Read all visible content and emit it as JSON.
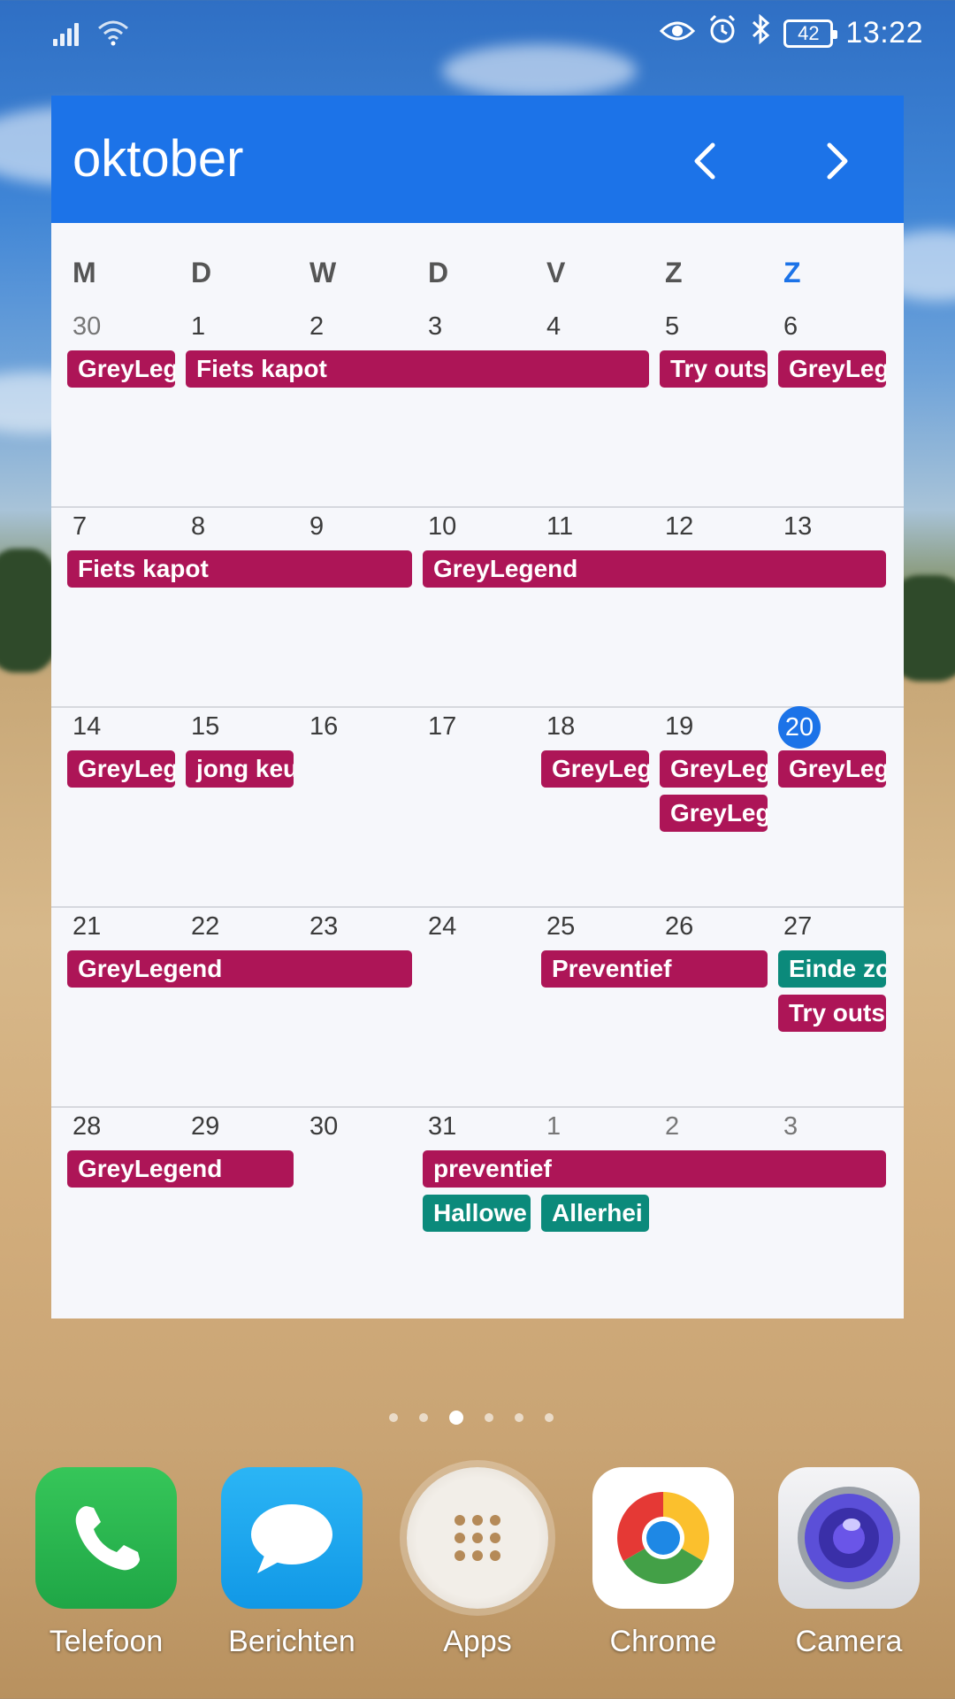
{
  "status_bar": {
    "battery": "42",
    "time": "13:22"
  },
  "widget": {
    "month": "oktober",
    "weekdays": [
      "M",
      "D",
      "W",
      "D",
      "V",
      "Z",
      "Z"
    ],
    "weeks": [
      {
        "days": [
          "30",
          "1",
          "2",
          "3",
          "4",
          "5",
          "6"
        ],
        "events": [
          "GreyLeg",
          "Fiets kapot",
          "Try outs",
          "GreyLeg"
        ]
      },
      {
        "days": [
          "7",
          "8",
          "9",
          "10",
          "11",
          "12",
          "13"
        ],
        "events": [
          "Fiets kapot",
          "GreyLegend"
        ]
      },
      {
        "days": [
          "14",
          "15",
          "16",
          "17",
          "18",
          "19",
          "20"
        ],
        "events": [
          "GreyLeg",
          "jong keu",
          "GreyLeg",
          "GreyLeg",
          "GreyLeg",
          "GreyLeg"
        ]
      },
      {
        "days": [
          "21",
          "22",
          "23",
          "24",
          "25",
          "26",
          "27"
        ],
        "events": [
          "GreyLegend",
          "Preventief",
          "Einde zo",
          "Try outs"
        ]
      },
      {
        "days": [
          "28",
          "29",
          "30",
          "31",
          "1",
          "2",
          "3"
        ],
        "events": [
          "GreyLegend",
          "preventief",
          "Hallowe",
          "Allerhei"
        ]
      }
    ],
    "colors": {
      "header": "#1c73e8",
      "event_red": "#ad1557",
      "event_green": "#0b8a7b"
    }
  },
  "page_indicator": {
    "count": 6,
    "active": 3
  },
  "dock": {
    "apps": [
      {
        "label": "Telefoon",
        "icon": "phone-icon"
      },
      {
        "label": "Berichten",
        "icon": "message-bubble-icon"
      },
      {
        "label": "Apps",
        "icon": "app-grid-icon"
      },
      {
        "label": "Chrome",
        "icon": "chrome-icon"
      },
      {
        "label": "Camera",
        "icon": "camera-lens-icon"
      }
    ]
  }
}
